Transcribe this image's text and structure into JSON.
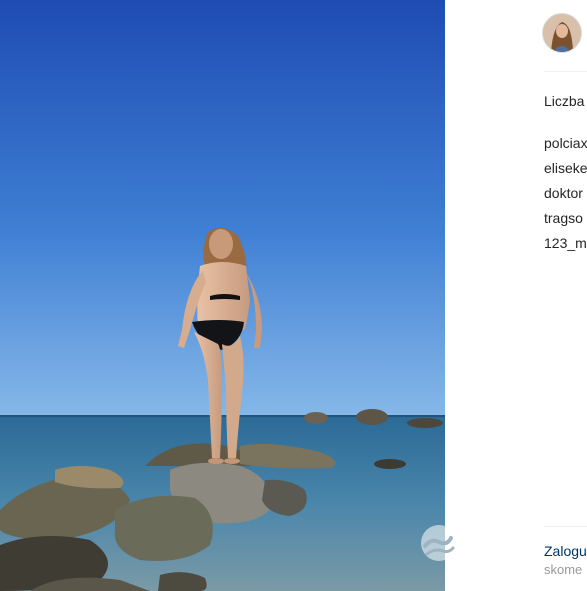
{
  "post": {
    "photo_alt": "woman in black bikini standing on a rock by the sea",
    "colors": {
      "sky_top": "#1f4fb8",
      "sky_bottom": "#7fb2e6",
      "sea": "#2f6f9a",
      "rock": "#5d5a4c"
    }
  },
  "sidebar": {
    "likes_label": "Liczba",
    "commenters": [
      "polciax",
      "eliseke",
      "doktor",
      "tragso",
      "123_m"
    ],
    "login_link": "Zalogu",
    "login_sub": "skome"
  },
  "icons": {
    "avatar": "user-avatar",
    "watermark": "wave-logo-icon"
  }
}
